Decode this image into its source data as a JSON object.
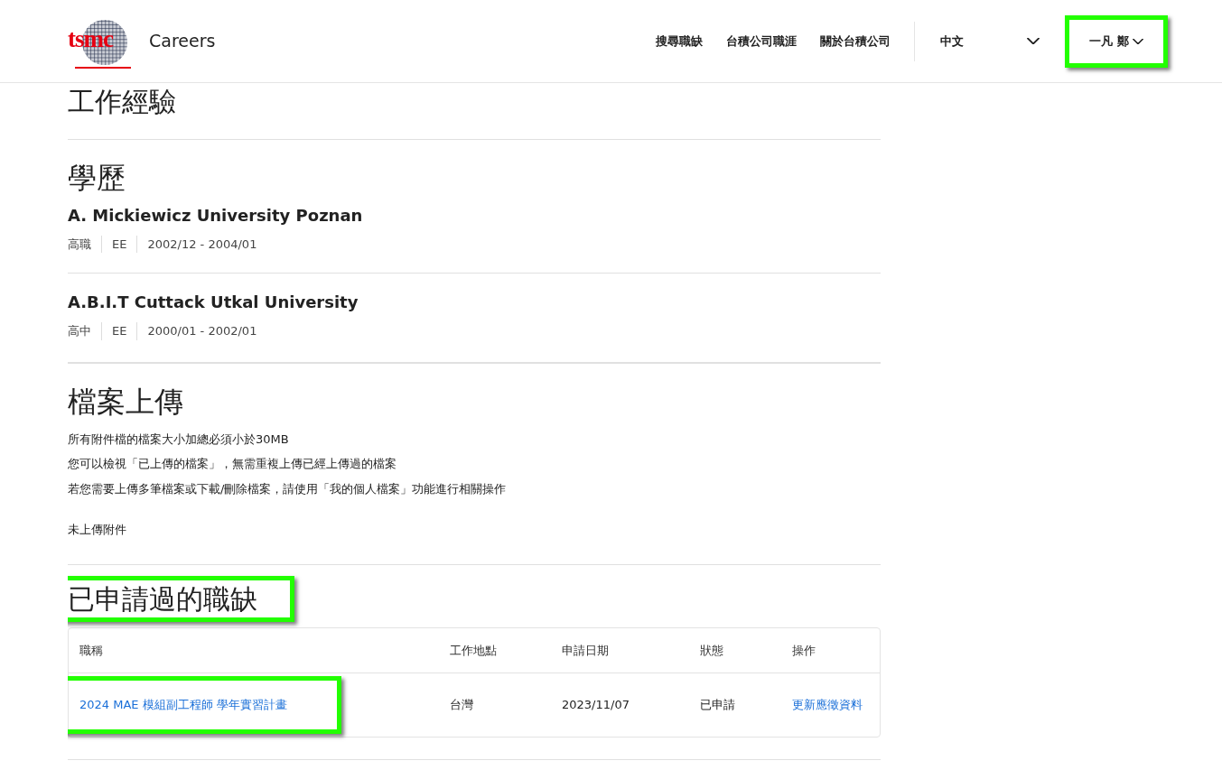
{
  "header": {
    "logo_text": "tsmc",
    "site_title": "Careers",
    "nav": [
      {
        "label": "搜尋職缺"
      },
      {
        "label": "台積公司職涯"
      },
      {
        "label": "關於台積公司"
      }
    ],
    "language": {
      "label": "中文"
    },
    "user_menu": {
      "label": "一凡 鄭",
      "highlighted": true
    }
  },
  "sections": [
    {
      "kind": "heading",
      "title": "工作經驗",
      "highlighted": false
    },
    {
      "kind": "education",
      "title": "學歷",
      "highlighted": false,
      "items": [
        {
          "school": "A. Mickiewicz University Poznan",
          "meta": [
            "高職",
            "EE",
            "2002/12 - 2004/01"
          ]
        },
        {
          "school": "A.B.I.T Cuttack Utkal University",
          "meta": [
            "高中",
            "EE",
            "2000/01 - 2002/01"
          ]
        }
      ]
    },
    {
      "kind": "files",
      "title": "檔案上傳",
      "highlighted": false,
      "notes": [
        "所有附件檔的檔案大小加總必須小於30MB",
        "您可以檢視「已上傳的檔案」，無需重複上傳已經上傳過的檔案",
        "若您需要上傳多筆檔案或下載/刪除檔案，請使用「我的個人檔案」功能進行相關操作"
      ],
      "empty_text": "未上傳附件"
    },
    {
      "kind": "applications",
      "title": "已申請過的職缺",
      "highlighted": true,
      "columns": [
        "職稱",
        "工作地點",
        "申請日期",
        "狀態",
        "操作"
      ],
      "rows": [
        {
          "title": "2024 MAE 模組副工程師 學年實習計畫",
          "highlighted": true,
          "location": "台灣",
          "date": "2023/11/07",
          "status": "已申請",
          "action": "更新應徵資料"
        }
      ]
    }
  ]
}
